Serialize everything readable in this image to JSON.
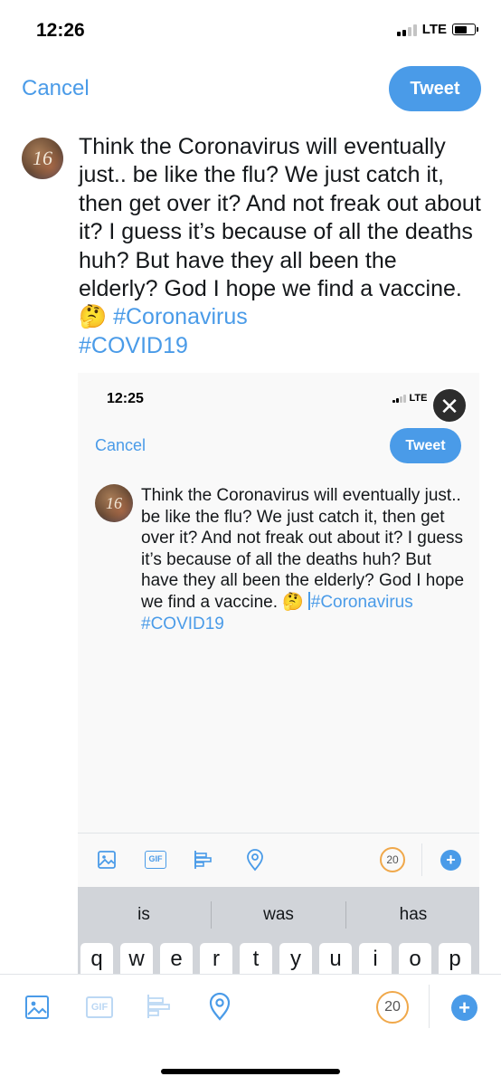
{
  "status_bar": {
    "time": "12:26",
    "network": "LTE"
  },
  "compose": {
    "cancel_label": "Cancel",
    "tweet_label": "Tweet",
    "avatar_text": "16",
    "text_plain": "Think the Coronavirus will eventually just.. be like the flu? We just catch it, then get over it? And not freak out about it? I guess it’s because of all the deaths huh? But have they all been the elderly? God I hope we find a vaccine. 🤔 ",
    "hashtag_1": "#Coronavirus",
    "hashtag_2": "#COVID19"
  },
  "embedded_screenshot": {
    "time": "12:25",
    "network": "LTE",
    "close_symbol": "✕",
    "cancel_label": "Cancel",
    "tweet_label": "Tweet",
    "avatar_text": "16",
    "text_plain": "Think the Coronavirus will eventually just.. be like the flu? We just catch it, then get over it? And not freak out about it? I guess it’s because of all the deaths huh? But have they all been the elderly? God I hope we find a vaccine. 🤔 ",
    "hashtag_1": "#Coronavirus",
    "hashtag_2": "#COVID19",
    "toolbar": {
      "gif_label": "GIF",
      "counter": "20",
      "plus": "+"
    },
    "keyboard": {
      "suggestions": [
        "is",
        "was",
        "has"
      ],
      "keys": [
        "q",
        "w",
        "e",
        "r",
        "t",
        "y",
        "u",
        "i",
        "o",
        "p"
      ]
    }
  },
  "toolbar": {
    "gif_label": "GIF",
    "counter": "20",
    "plus": "+",
    "icons": [
      "image-icon",
      "gif-icon",
      "poll-icon",
      "location-icon"
    ],
    "accent_color": "#4a9be8",
    "counter_ring_color": "#f0a84a"
  }
}
